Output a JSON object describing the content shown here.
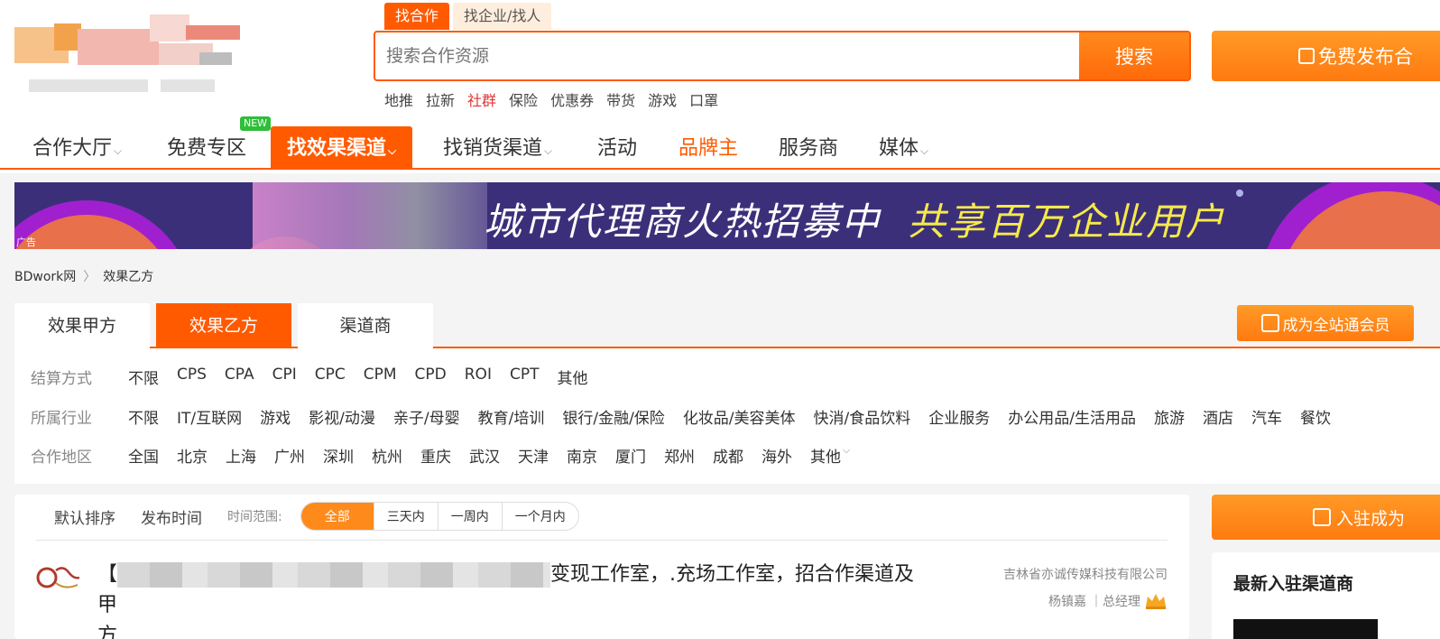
{
  "header": {
    "search_tabs": [
      "找合作",
      "找企业/找人"
    ],
    "search_placeholder": "搜索合作资源",
    "search_button": "搜索",
    "publish_button": "免费发布合",
    "hot_words": [
      "地推",
      "拉新",
      "社群",
      "保险",
      "优惠券",
      "带货",
      "游戏",
      "口罩"
    ],
    "hot_word_highlight": "社群"
  },
  "nav": {
    "items": [
      "合作大厅",
      "免费专区",
      "找效果渠道",
      "找销货渠道",
      "活动",
      "品牌主",
      "服务商",
      "媒体"
    ],
    "new_badge": "NEW",
    "active": "找效果渠道"
  },
  "banner": {
    "text_main": "城市代理商火热招募中",
    "text_highlight": "共享百万企业用户",
    "ad_label": "广告"
  },
  "breadcrumb": [
    "BDwork网",
    "效果乙方"
  ],
  "filter": {
    "tabs": [
      "效果甲方",
      "效果乙方",
      "渠道商"
    ],
    "active_tab": "效果乙方",
    "member_button": "成为全站通会员",
    "rows": [
      {
        "label": "结算方式",
        "options": [
          "不限",
          "CPS",
          "CPA",
          "CPI",
          "CPC",
          "CPM",
          "CPD",
          "ROI",
          "CPT",
          "其他"
        ]
      },
      {
        "label": "所属行业",
        "options": [
          "不限",
          "IT/互联网",
          "游戏",
          "影视/动漫",
          "亲子/母婴",
          "教育/培训",
          "银行/金融/保险",
          "化妆品/美容美体",
          "快消/食品饮料",
          "企业服务",
          "办公用品/生活用品",
          "旅游",
          "酒店",
          "汽车",
          "餐饮"
        ]
      },
      {
        "label": "合作地区",
        "options": [
          "全国",
          "北京",
          "上海",
          "广州",
          "深圳",
          "杭州",
          "重庆",
          "武汉",
          "天津",
          "南京",
          "厦门",
          "郑州",
          "成都",
          "海外",
          "其他"
        ]
      }
    ]
  },
  "list": {
    "sort_options": [
      "默认排序",
      "发布时间"
    ],
    "time_range_label": "时间范围:",
    "time_ranges": [
      "全部",
      "三天内",
      "一周内",
      "一个月内"
    ],
    "active_range": "全部",
    "item": {
      "title_prefix": "【",
      "title_rest": "变现工作室，.充场工作室，招合作渠道及甲",
      "title_wrap": "方",
      "company": "吉林省亦诚传媒科技有限公司",
      "contact_name": "杨镇嘉",
      "contact_role": "｜总经理"
    }
  },
  "sidebar": {
    "join_button": "入驻成为",
    "latest_title": "最新入驻渠道商"
  },
  "colors": {
    "accent": "#ff5a00",
    "accent_light": "#ff8a1c",
    "banner_bg": "#3c2f7a",
    "highlight_yellow": "#f5e94b"
  }
}
